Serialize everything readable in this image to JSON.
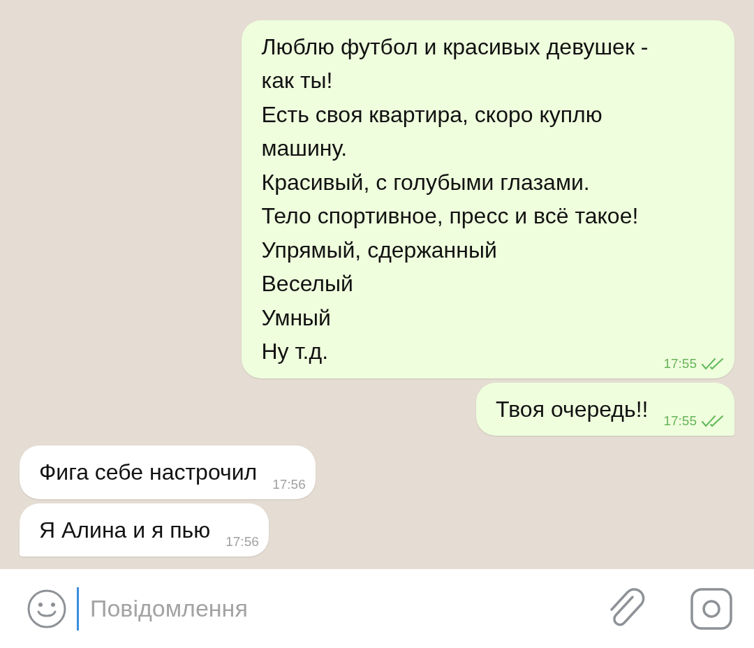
{
  "messages": [
    {
      "outgoing": true,
      "text": "Люблю футбол и красивых девушек -\nкак ты!\nЕсть своя квартира, скоро куплю\nмашину.\nКрасивый, с голубыми глазами.\nТело спортивное, пресс и всё такое!\nУпрямый, сдержанный\nВеселый\nУмный\nНу т.д.",
      "time": "17:55",
      "read": true,
      "tail": false
    },
    {
      "outgoing": true,
      "text": "Твоя очередь!!",
      "time": "17:55",
      "read": true,
      "tail": true
    },
    {
      "outgoing": false,
      "text": "Фига себе настрочил",
      "time": "17:56",
      "tail": false
    },
    {
      "outgoing": false,
      "text": "Я Алина и я пью",
      "time": "17:56",
      "tail": true
    }
  ],
  "composer": {
    "placeholder": "Повідомлення"
  }
}
